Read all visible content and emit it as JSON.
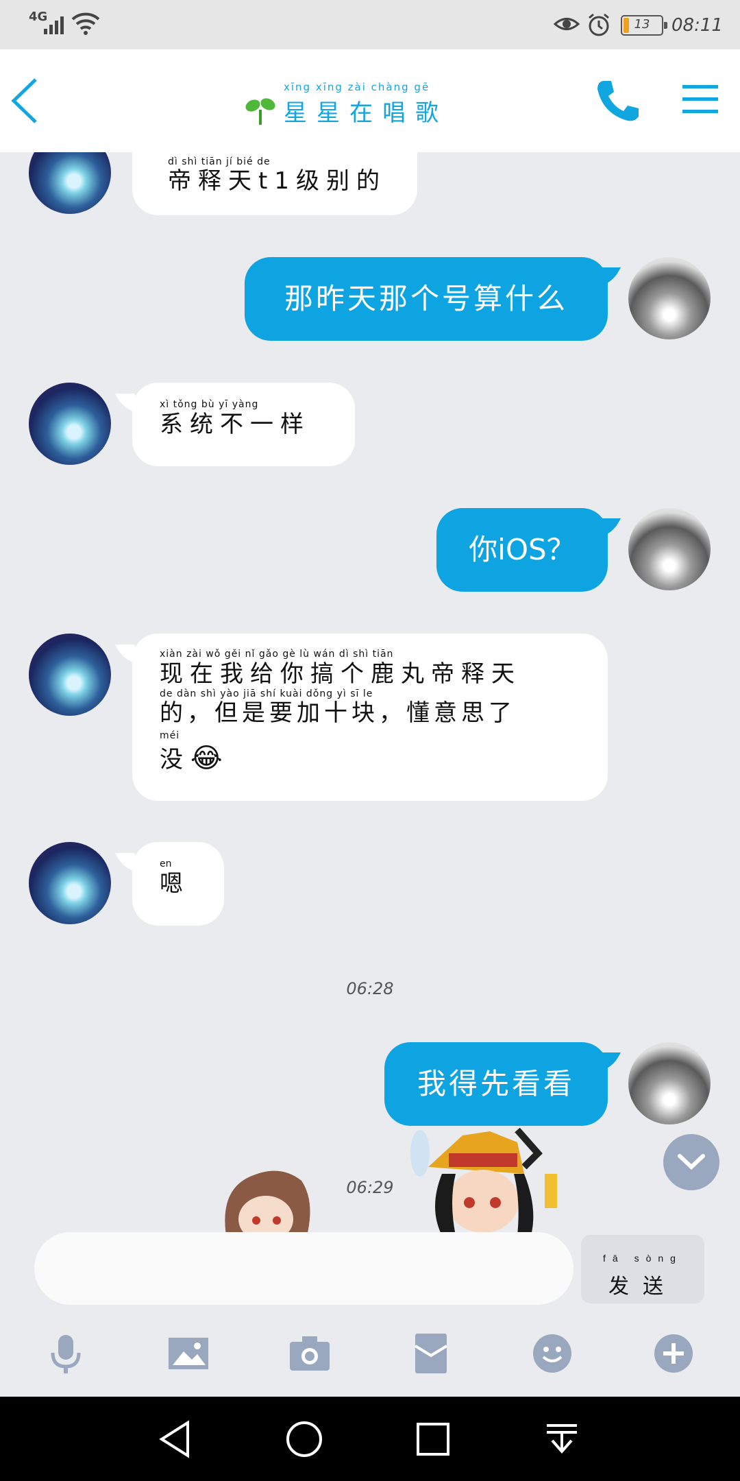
{
  "status_bar": {
    "network": "4G",
    "battery_level": "13",
    "battery_fraction": 0.13,
    "time": "08:11",
    "icons": [
      "signal-icon",
      "wifi-icon",
      "eye-icon",
      "alarm-icon",
      "battery-icon"
    ]
  },
  "header": {
    "title": "星星在唱歌",
    "title_pinyin": "xīng  xīng  zài  chàng  gē",
    "accent_color": "#12a6e0"
  },
  "messages": [
    {
      "side": "in",
      "text": "帝释天t1级别的",
      "pinyin": "dì  shì  tiān          jí  bié  de"
    },
    {
      "side": "out",
      "text": "那昨天那个号算什么"
    },
    {
      "side": "in",
      "text": "系统不一样",
      "pinyin": "xì  tǒng  bù  yī  yàng"
    },
    {
      "side": "out",
      "text": "你iOS？"
    },
    {
      "side": "in",
      "lines": [
        {
          "text": "现在我给你搞个鹿丸帝释天",
          "pinyin": "xiàn  zài  wǒ  gěi  nǐ  gǎo  gè  lù  wán  dì  shì  tiān"
        },
        {
          "text": "的，但是要加十块，懂意思了",
          "pinyin": "de    dàn  shì  yào  jiā  shí  kuài  dǒng  yì  sī  le"
        },
        {
          "text": "没",
          "pinyin": "méi"
        }
      ],
      "emoji": "😂"
    },
    {
      "side": "in",
      "text": "嗯",
      "pinyin": "en"
    },
    {
      "side": "out",
      "text": "我得先看看"
    }
  ],
  "timestamps": [
    "06:28",
    "06:29"
  ],
  "input": {
    "value": "",
    "placeholder": ""
  },
  "send_button": {
    "label": "发送",
    "pinyin": "fā sòng"
  },
  "toolbar": [
    "microphone-icon",
    "image-icon",
    "camera-icon",
    "red-envelope-icon",
    "emoji-icon",
    "plus-icon"
  ],
  "navbar": [
    "back-triangle-icon",
    "home-circle-icon",
    "recents-square-icon",
    "notification-pull-icon"
  ],
  "colors": {
    "bubble_out": "#0ea3e1",
    "bubble_in": "#ffffff",
    "background": "#e9ebef"
  }
}
